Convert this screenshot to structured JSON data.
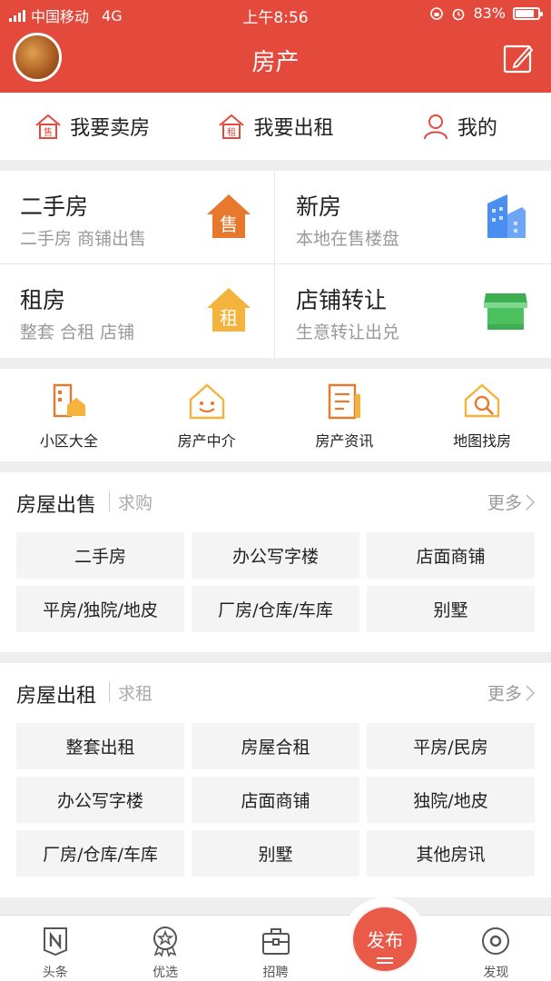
{
  "status": {
    "carrier": "中国移动",
    "network": "4G",
    "time": "上午8:56",
    "battery": "83%"
  },
  "header": {
    "title": "房产"
  },
  "quick_actions": [
    {
      "label": "我要卖房",
      "icon": "sell-house-icon"
    },
    {
      "label": "我要出租",
      "icon": "rent-house-icon"
    },
    {
      "label": "我的",
      "icon": "user-icon"
    }
  ],
  "categories": [
    {
      "title": "二手房",
      "subtitle": "二手房 商铺出售",
      "icon_text": "售"
    },
    {
      "title": "新房",
      "subtitle": "本地在售楼盘",
      "icon_text": ""
    },
    {
      "title": "租房",
      "subtitle": "整套 合租 店铺",
      "icon_text": "租"
    },
    {
      "title": "店铺转让",
      "subtitle": "生意转让出兑",
      "icon_text": ""
    }
  ],
  "services": [
    {
      "label": "小区大全",
      "icon": "building-icon"
    },
    {
      "label": "房产中介",
      "icon": "smile-house-icon"
    },
    {
      "label": "房产资讯",
      "icon": "news-icon"
    },
    {
      "label": "地图找房",
      "icon": "map-search-icon"
    }
  ],
  "sale": {
    "title": "房屋出售",
    "sub": "求购",
    "more": "更多",
    "items": [
      "二手房",
      "办公写字楼",
      "店面商铺",
      "平房/独院/地皮",
      "厂房/仓库/车库",
      "别墅"
    ]
  },
  "rent": {
    "title": "房屋出租",
    "sub": "求租",
    "more": "更多",
    "items": [
      "整套出租",
      "房屋合租",
      "平房/民房",
      "办公写字楼",
      "店面商铺",
      "独院/地皮",
      "厂房/仓库/车库",
      "别墅",
      "其他房讯"
    ]
  },
  "tabs": [
    {
      "label": "头条",
      "icon": "news-n-icon"
    },
    {
      "label": "优选",
      "icon": "star-badge-icon"
    },
    {
      "label": "招聘",
      "icon": "briefcase-icon"
    },
    {
      "label": "发现",
      "icon": "discover-icon"
    }
  ],
  "publish": {
    "label": "发布"
  },
  "colors": {
    "brand": "#e34a3c",
    "orange": "#e8782e",
    "yellow": "#f3b33d",
    "blue": "#4a8ef0",
    "green": "#4cc25e"
  }
}
